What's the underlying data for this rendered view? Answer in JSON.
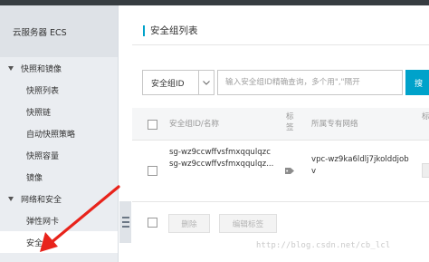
{
  "sidebar": {
    "title": "云服务器 ECS",
    "groups": [
      {
        "label": "快照和镜像",
        "items": [
          "快照列表",
          "快照链",
          "自动快照策略",
          "快照容量",
          "镜像"
        ]
      },
      {
        "label": "网络和安全",
        "items": [
          "弹性网卡",
          "安全组"
        ]
      }
    ],
    "active_item": "安全组"
  },
  "main": {
    "title": "安全组列表",
    "filter": {
      "select_value": "安全组ID",
      "search_placeholder": "输入安全组ID精确查询，多个用\",\"隔开",
      "search_button": "搜"
    },
    "table": {
      "headers": {
        "id_name": "安全组ID/名称",
        "tag": "标签",
        "vpc": "所属专有网络",
        "extra": "标"
      },
      "rows": [
        {
          "id": "sg-wz9ccwffvsfmxqqulqzc",
          "name": "sg-wz9ccwffvsfmxqqulqz...",
          "vpc": "vpc-wz9ka6ldlj7jkolddjobv"
        }
      ]
    },
    "actions": {
      "delete": "删除",
      "edit_tags": "编辑标签"
    }
  },
  "watermark": "http://blog.csdn.net/cb_lcl",
  "colors": {
    "accent": "#00a2ca",
    "annotation_arrow": "#e8231b",
    "sidebar_bg": "#eaedf1"
  }
}
